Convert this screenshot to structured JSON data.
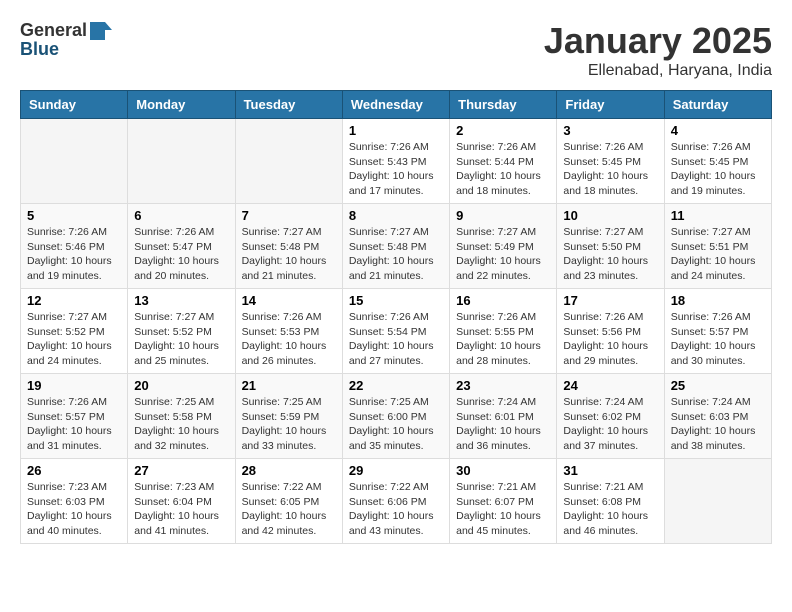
{
  "header": {
    "logo_general": "General",
    "logo_blue": "Blue",
    "month_title": "January 2025",
    "location": "Ellenabad, Haryana, India"
  },
  "weekdays": [
    "Sunday",
    "Monday",
    "Tuesday",
    "Wednesday",
    "Thursday",
    "Friday",
    "Saturday"
  ],
  "weeks": [
    [
      {
        "day": "",
        "info": ""
      },
      {
        "day": "",
        "info": ""
      },
      {
        "day": "",
        "info": ""
      },
      {
        "day": "1",
        "info": "Sunrise: 7:26 AM\nSunset: 5:43 PM\nDaylight: 10 hours\nand 17 minutes."
      },
      {
        "day": "2",
        "info": "Sunrise: 7:26 AM\nSunset: 5:44 PM\nDaylight: 10 hours\nand 18 minutes."
      },
      {
        "day": "3",
        "info": "Sunrise: 7:26 AM\nSunset: 5:45 PM\nDaylight: 10 hours\nand 18 minutes."
      },
      {
        "day": "4",
        "info": "Sunrise: 7:26 AM\nSunset: 5:45 PM\nDaylight: 10 hours\nand 19 minutes."
      }
    ],
    [
      {
        "day": "5",
        "info": "Sunrise: 7:26 AM\nSunset: 5:46 PM\nDaylight: 10 hours\nand 19 minutes."
      },
      {
        "day": "6",
        "info": "Sunrise: 7:26 AM\nSunset: 5:47 PM\nDaylight: 10 hours\nand 20 minutes."
      },
      {
        "day": "7",
        "info": "Sunrise: 7:27 AM\nSunset: 5:48 PM\nDaylight: 10 hours\nand 21 minutes."
      },
      {
        "day": "8",
        "info": "Sunrise: 7:27 AM\nSunset: 5:48 PM\nDaylight: 10 hours\nand 21 minutes."
      },
      {
        "day": "9",
        "info": "Sunrise: 7:27 AM\nSunset: 5:49 PM\nDaylight: 10 hours\nand 22 minutes."
      },
      {
        "day": "10",
        "info": "Sunrise: 7:27 AM\nSunset: 5:50 PM\nDaylight: 10 hours\nand 23 minutes."
      },
      {
        "day": "11",
        "info": "Sunrise: 7:27 AM\nSunset: 5:51 PM\nDaylight: 10 hours\nand 24 minutes."
      }
    ],
    [
      {
        "day": "12",
        "info": "Sunrise: 7:27 AM\nSunset: 5:52 PM\nDaylight: 10 hours\nand 24 minutes."
      },
      {
        "day": "13",
        "info": "Sunrise: 7:27 AM\nSunset: 5:52 PM\nDaylight: 10 hours\nand 25 minutes."
      },
      {
        "day": "14",
        "info": "Sunrise: 7:26 AM\nSunset: 5:53 PM\nDaylight: 10 hours\nand 26 minutes."
      },
      {
        "day": "15",
        "info": "Sunrise: 7:26 AM\nSunset: 5:54 PM\nDaylight: 10 hours\nand 27 minutes."
      },
      {
        "day": "16",
        "info": "Sunrise: 7:26 AM\nSunset: 5:55 PM\nDaylight: 10 hours\nand 28 minutes."
      },
      {
        "day": "17",
        "info": "Sunrise: 7:26 AM\nSunset: 5:56 PM\nDaylight: 10 hours\nand 29 minutes."
      },
      {
        "day": "18",
        "info": "Sunrise: 7:26 AM\nSunset: 5:57 PM\nDaylight: 10 hours\nand 30 minutes."
      }
    ],
    [
      {
        "day": "19",
        "info": "Sunrise: 7:26 AM\nSunset: 5:57 PM\nDaylight: 10 hours\nand 31 minutes."
      },
      {
        "day": "20",
        "info": "Sunrise: 7:25 AM\nSunset: 5:58 PM\nDaylight: 10 hours\nand 32 minutes."
      },
      {
        "day": "21",
        "info": "Sunrise: 7:25 AM\nSunset: 5:59 PM\nDaylight: 10 hours\nand 33 minutes."
      },
      {
        "day": "22",
        "info": "Sunrise: 7:25 AM\nSunset: 6:00 PM\nDaylight: 10 hours\nand 35 minutes."
      },
      {
        "day": "23",
        "info": "Sunrise: 7:24 AM\nSunset: 6:01 PM\nDaylight: 10 hours\nand 36 minutes."
      },
      {
        "day": "24",
        "info": "Sunrise: 7:24 AM\nSunset: 6:02 PM\nDaylight: 10 hours\nand 37 minutes."
      },
      {
        "day": "25",
        "info": "Sunrise: 7:24 AM\nSunset: 6:03 PM\nDaylight: 10 hours\nand 38 minutes."
      }
    ],
    [
      {
        "day": "26",
        "info": "Sunrise: 7:23 AM\nSunset: 6:03 PM\nDaylight: 10 hours\nand 40 minutes."
      },
      {
        "day": "27",
        "info": "Sunrise: 7:23 AM\nSunset: 6:04 PM\nDaylight: 10 hours\nand 41 minutes."
      },
      {
        "day": "28",
        "info": "Sunrise: 7:22 AM\nSunset: 6:05 PM\nDaylight: 10 hours\nand 42 minutes."
      },
      {
        "day": "29",
        "info": "Sunrise: 7:22 AM\nSunset: 6:06 PM\nDaylight: 10 hours\nand 43 minutes."
      },
      {
        "day": "30",
        "info": "Sunrise: 7:21 AM\nSunset: 6:07 PM\nDaylight: 10 hours\nand 45 minutes."
      },
      {
        "day": "31",
        "info": "Sunrise: 7:21 AM\nSunset: 6:08 PM\nDaylight: 10 hours\nand 46 minutes."
      },
      {
        "day": "",
        "info": ""
      }
    ]
  ]
}
